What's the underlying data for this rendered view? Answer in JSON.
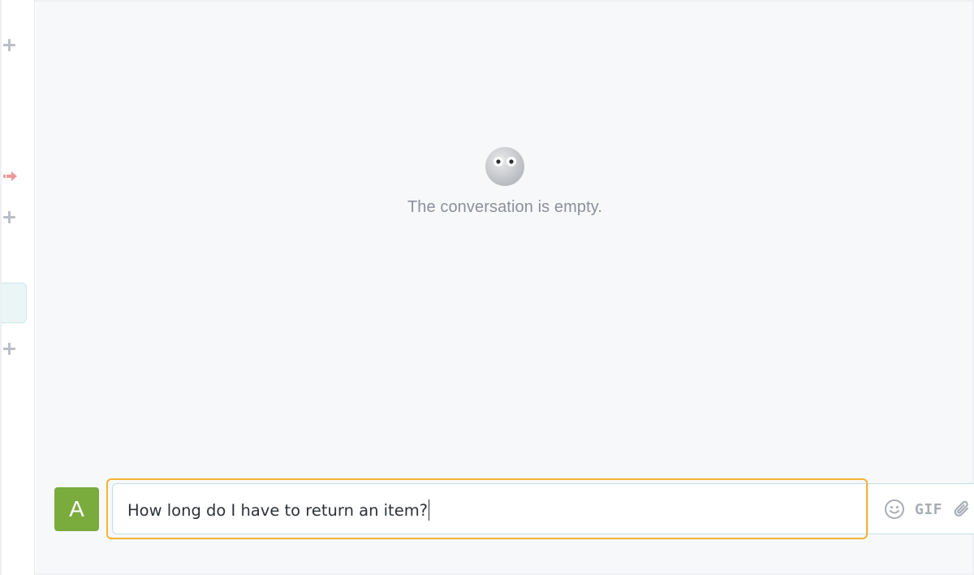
{
  "empty_state": {
    "message": "The conversation is empty.",
    "icon": "eyes-face-icon"
  },
  "composer": {
    "avatar_initial": "A",
    "avatar_color": "#7aab3d",
    "input_value": "How long do I have to return an item?",
    "focus_color": "#f5b335",
    "tools": {
      "emoji_icon": "smiley-icon",
      "gif_label": "GIF",
      "attach_icon": "paperclip-icon"
    }
  },
  "left_rail": {
    "icons": [
      "plus-icon",
      "arrow-right-icon",
      "plus-icon",
      "plus-icon"
    ]
  }
}
